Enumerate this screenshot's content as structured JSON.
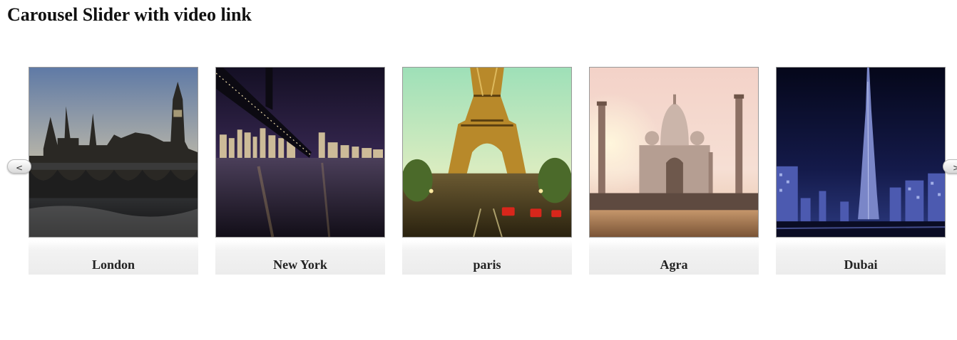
{
  "page": {
    "title": "Carousel Slider with video link"
  },
  "carousel": {
    "prev_label": "<",
    "next_label": ">",
    "slides": [
      {
        "caption": "London",
        "image": "london-parliament-photo"
      },
      {
        "caption": "New York",
        "image": "new-york-bridge-night-photo"
      },
      {
        "caption": "paris",
        "image": "paris-eiffel-tower-photo"
      },
      {
        "caption": "Agra",
        "image": "agra-taj-mahal-photo"
      },
      {
        "caption": "Dubai",
        "image": "dubai-burj-khalifa-night-photo"
      }
    ]
  },
  "colors": {
    "caption_bg": "#efefef",
    "text": "#222222"
  }
}
